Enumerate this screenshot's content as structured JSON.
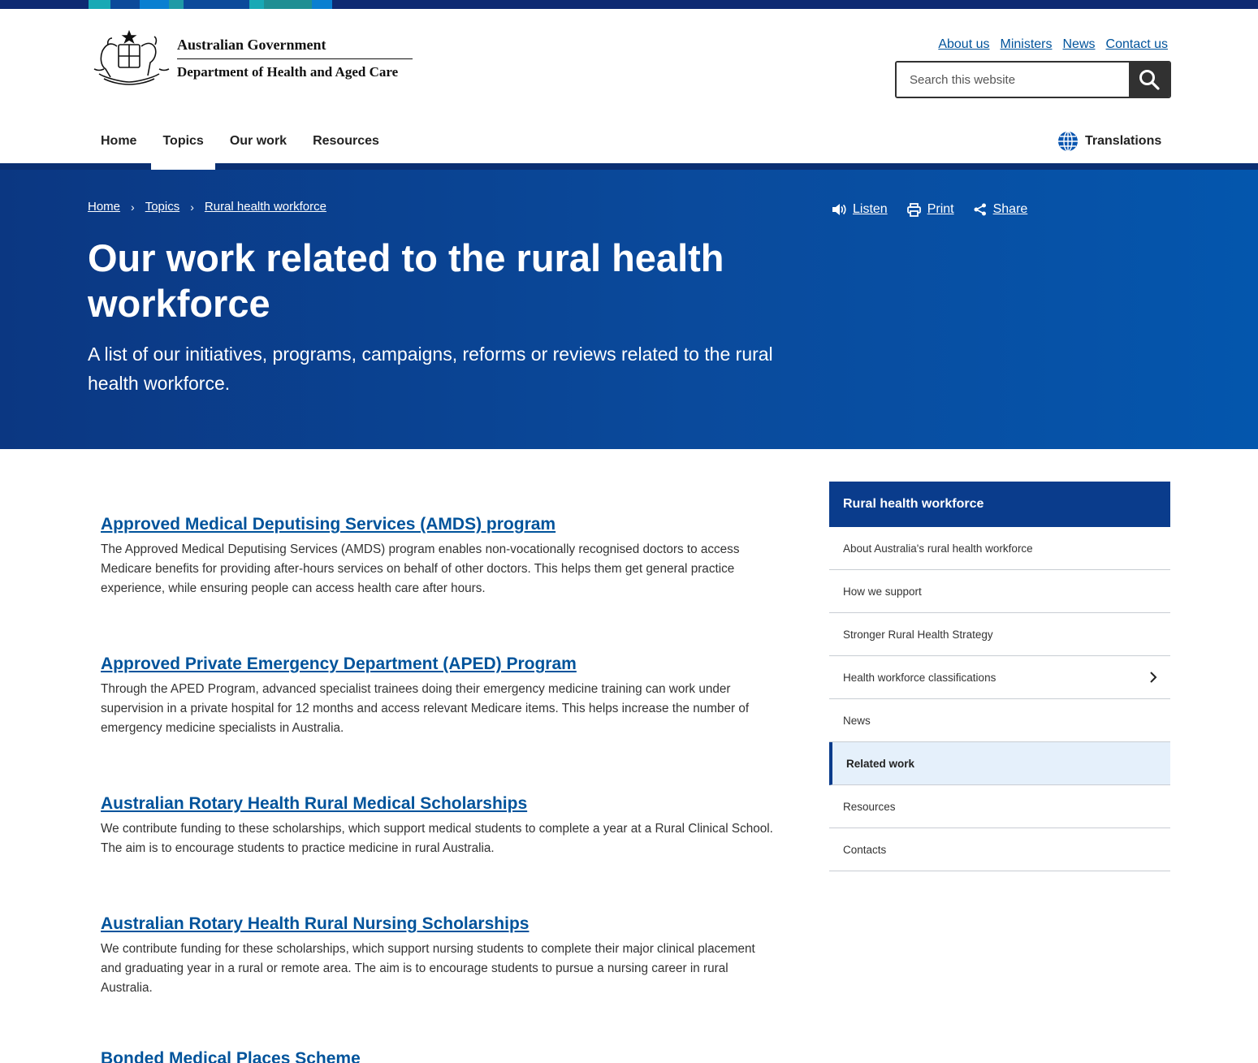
{
  "header": {
    "gov_name": "Australian Government",
    "dept_name": "Department of Health and Aged Care",
    "utility_links": [
      "About us",
      "Ministers",
      "News",
      "Contact us"
    ],
    "search_placeholder": "Search this website",
    "nav": [
      "Home",
      "Topics",
      "Our work",
      "Resources"
    ],
    "translations_label": "Translations",
    "strip_colors": [
      "#0e2a72",
      "#18a9b5",
      "#0c4a9a",
      "#0a7fd1",
      "#1f9aa6",
      "#0c4a9a",
      "#18a9b5",
      "#1f8f93",
      "#0a7fd1"
    ]
  },
  "hero": {
    "breadcrumb": [
      "Home",
      "Topics",
      "Rural health workforce"
    ],
    "tools": {
      "listen": "Listen",
      "print": "Print",
      "share": "Share"
    },
    "title": "Our work related to the rural health workforce",
    "lead": "A list of our initiatives, programs, campaigns, reforms or reviews related to the rural health workforce."
  },
  "entries": [
    {
      "title": "Approved Medical Deputising Services (AMDS) program",
      "desc": "The Approved Medical Deputising Services (AMDS) program enables non-vocationally recognised doctors to access Medicare benefits for providing after-hours services on behalf of other doctors. This helps them get general practice experience, while ensuring people can access health care after hours."
    },
    {
      "title": "Approved Private Emergency Department (APED) Program",
      "desc": "Through the APED Program, advanced specialist trainees doing their emergency medicine training can work under supervision in a private hospital for 12 months and access relevant Medicare items. This helps increase the number of emergency medicine specialists in Australia."
    },
    {
      "title": "Australian Rotary Health Rural Medical Scholarships",
      "desc": "We contribute funding to these scholarships, which support medical students to complete a year at a Rural Clinical School. The aim is to encourage students to practice medicine in rural Australia."
    },
    {
      "title": "Australian Rotary Health Rural Nursing Scholarships",
      "desc": "We contribute funding for these scholarships, which support nursing students to complete their major clinical placement and graduating year in a rural or remote area. The aim is to encourage students to pursue a nursing career in rural Australia."
    },
    {
      "title": "Bonded Medical Places Scheme",
      "desc": ""
    }
  ],
  "sidenav": {
    "heading": "Rural health workforce",
    "items": [
      "About Australia's rural health workforce",
      "How we support",
      "Stronger Rural Health Strategy",
      "Health workforce classifications",
      "News",
      "Related work",
      "Resources",
      "Contacts"
    ],
    "current": "Related work"
  }
}
